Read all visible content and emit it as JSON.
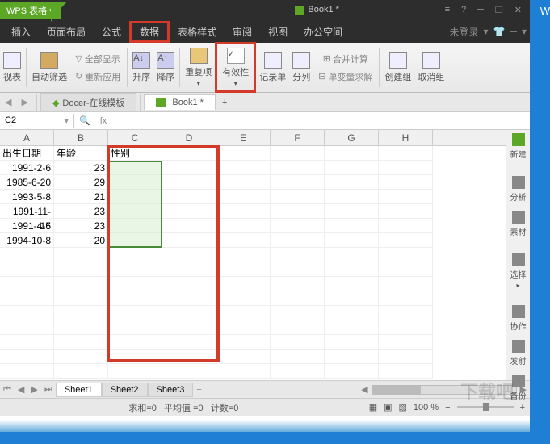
{
  "app_name": "WPS 表格",
  "doc_title": "Book1 *",
  "win_buttons": {
    "min": "─",
    "restore": "❐",
    "close": "✕",
    "help": "?",
    "menu": "≡"
  },
  "menu": [
    "插入",
    "页面布局",
    "公式",
    "数据",
    "表格样式",
    "审阅",
    "视图",
    "办公空间"
  ],
  "menu_highlight_index": 3,
  "menu_right": {
    "login": "未登录",
    "dd": "▾",
    "skin": "👕",
    "help": "?",
    "more": "▾"
  },
  "toolbar": {
    "pivot": "视表",
    "auto_filter": "自动筛选",
    "show_all": "全部显示",
    "reapply": "重新应用",
    "asc": "升序",
    "desc": "降序",
    "dup": "重复项",
    "validity": "有效性",
    "form": "记录单",
    "col": "分列",
    "consol": "合并计算",
    "solver": "单变量求解",
    "group": "创建组",
    "ungroup": "取消组"
  },
  "doc_tabs": {
    "docer": "Docer-在线模板",
    "book": "Book1 *"
  },
  "namebox": "C2",
  "fx": "fx",
  "cols": [
    "A",
    "B",
    "C",
    "D",
    "E",
    "F",
    "G",
    "H"
  ],
  "rows": [
    {
      "a": "出生日期",
      "b": "年龄",
      "c": "性别"
    },
    {
      "a": "1991-2-6",
      "b": "23",
      "c": ""
    },
    {
      "a": "1985-6-20",
      "b": "29",
      "c": ""
    },
    {
      "a": "1993-5-8",
      "b": "21",
      "c": ""
    },
    {
      "a": "1991-11-15",
      "b": "23",
      "c": ""
    },
    {
      "a": "1991-4-6",
      "b": "23",
      "c": ""
    },
    {
      "a": "1994-10-8",
      "b": "20",
      "c": ""
    }
  ],
  "side": {
    "new": "新建",
    "analyze": "分析",
    "material": "素材",
    "select": "选择",
    "collab": "协作",
    "send": "发射",
    "backup": "备份"
  },
  "sheets": [
    "Sheet1",
    "Sheet2",
    "Sheet3"
  ],
  "status": {
    "sum": "求和=0",
    "avg": "平均值 =0",
    "count": "计数=0",
    "zoom": "100 %"
  },
  "watermark": "下载吧",
  "ext": "W"
}
